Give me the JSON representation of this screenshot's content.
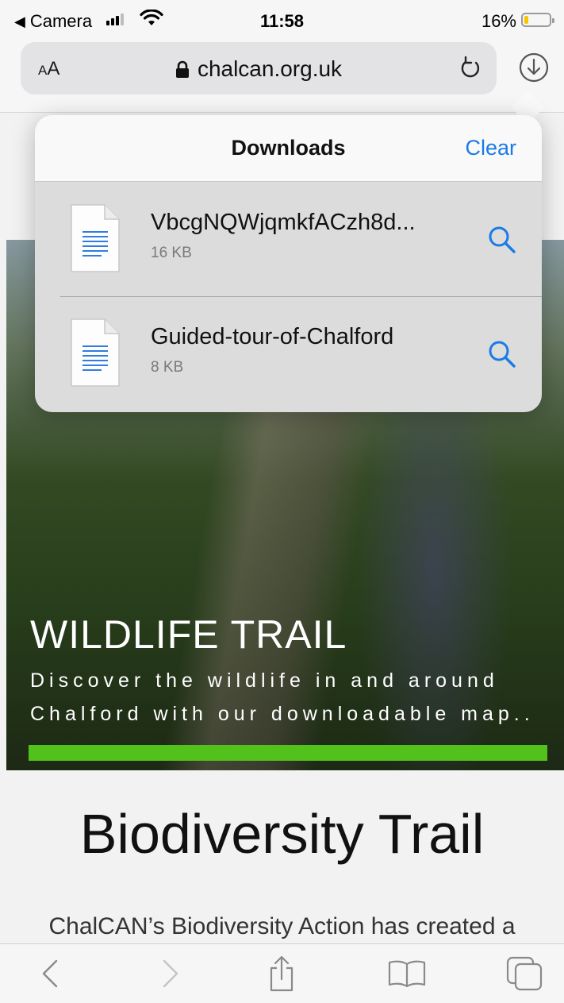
{
  "status_bar": {
    "back_app": "Camera",
    "time": "11:58",
    "battery_pct": "16%",
    "battery_level": 0.16,
    "battery_color": "#f7c500"
  },
  "browser": {
    "text_size_label_small": "A",
    "text_size_label_large": "A",
    "url": "chalcan.org.uk",
    "icons": [
      "lock-icon",
      "reload-icon",
      "download-icon"
    ]
  },
  "downloads": {
    "title": "Downloads",
    "clear_label": "Clear",
    "items": [
      {
        "name": "VbcgNQWjqmkfACzh8d...",
        "size": "16 KB"
      },
      {
        "name": "Guided-tour-of-Chalford",
        "size": "8 KB"
      }
    ],
    "accent_color": "#1a7be6"
  },
  "hero": {
    "title": "WILDLIFE TRAIL",
    "subtitle": "Discover the wildlife in and around Chalford with our downloadable map..",
    "progress_color": "#53c11c"
  },
  "page": {
    "heading": "Biodiversity Trail",
    "paragraph_start": "ChalCAN’s Biodiversity Action has created a"
  },
  "toolbar": {
    "icons": [
      "back-icon",
      "forward-icon",
      "share-icon",
      "bookmarks-icon",
      "tabs-icon"
    ]
  }
}
